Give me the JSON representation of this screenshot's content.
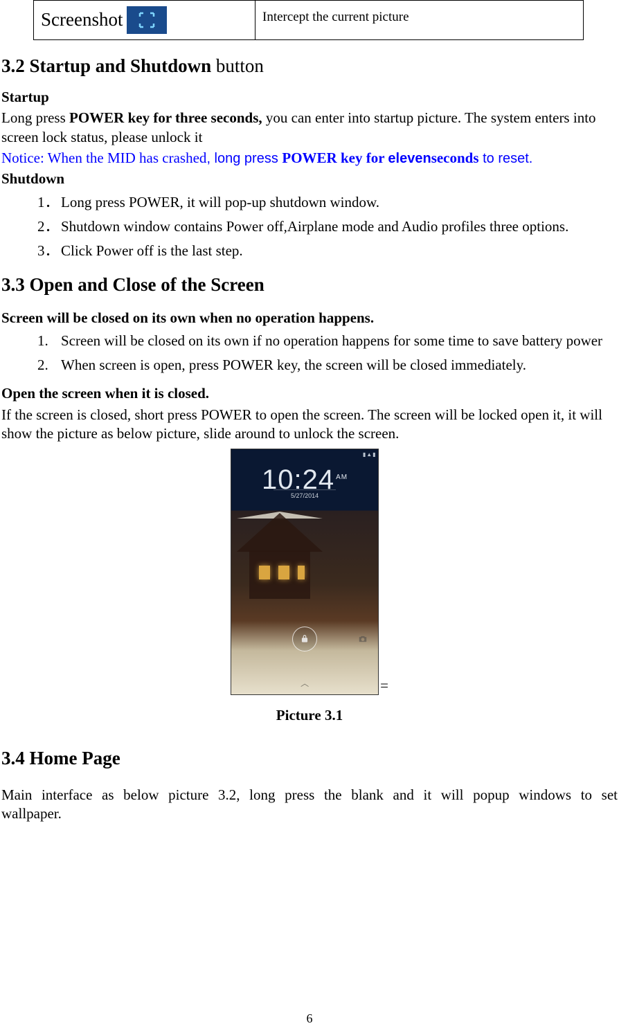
{
  "top_table": {
    "left_label": "Screenshot",
    "right_text": "Intercept the current picture"
  },
  "sec32": {
    "heading_bold": "3.2 Startup and Shutdown",
    "heading_rest": " button",
    "startup_label": "Startup",
    "startup_p_pre": "Long press ",
    "startup_p_bold": "POWER key for three seconds,",
    "startup_p_post": " you can enter into startup picture. The system enters into screen lock status, please unlock it",
    "notice_pre": "Notice: When the MID has crashed",
    "notice_comma_long": ", long press ",
    "notice_bold": "POWER key for ",
    "notice_eleven": "eleven",
    "notice_seconds": "seconds",
    "notice_reset": " to reset.",
    "shutdown_label": "Shutdown",
    "shutdown_items": [
      "Long press POWER, it will pop-up shutdown window.",
      "Shutdown window contains Power off,Airplane mode and Audio profiles three options.",
      "Click Power off is the last step."
    ]
  },
  "sec33": {
    "heading": "3.3 Open and Close of the Screen",
    "sub1": "Screen will be closed on its own when no operation happens.",
    "items1": [
      "Screen will be closed on its own if no operation happens for some time to save battery power",
      "When screen is open, press POWER key, the screen will be closed immediately."
    ],
    "sub2": "Open the screen when it is closed.",
    "para2": "If the screen is closed, short press POWER to open the screen. The screen will be locked open it, it will show the picture as below picture, slide around to unlock the screen.",
    "lockscreen": {
      "time": "10:24",
      "ampm": "AM",
      "date": "5/27/2014"
    },
    "eq": "=",
    "caption": "Picture 3.1"
  },
  "sec34": {
    "heading": "3.4 Home Page",
    "para": "Main interface as below picture 3.2, long press the blank and it will popup windows to set wallpaper."
  },
  "page_number": "6"
}
